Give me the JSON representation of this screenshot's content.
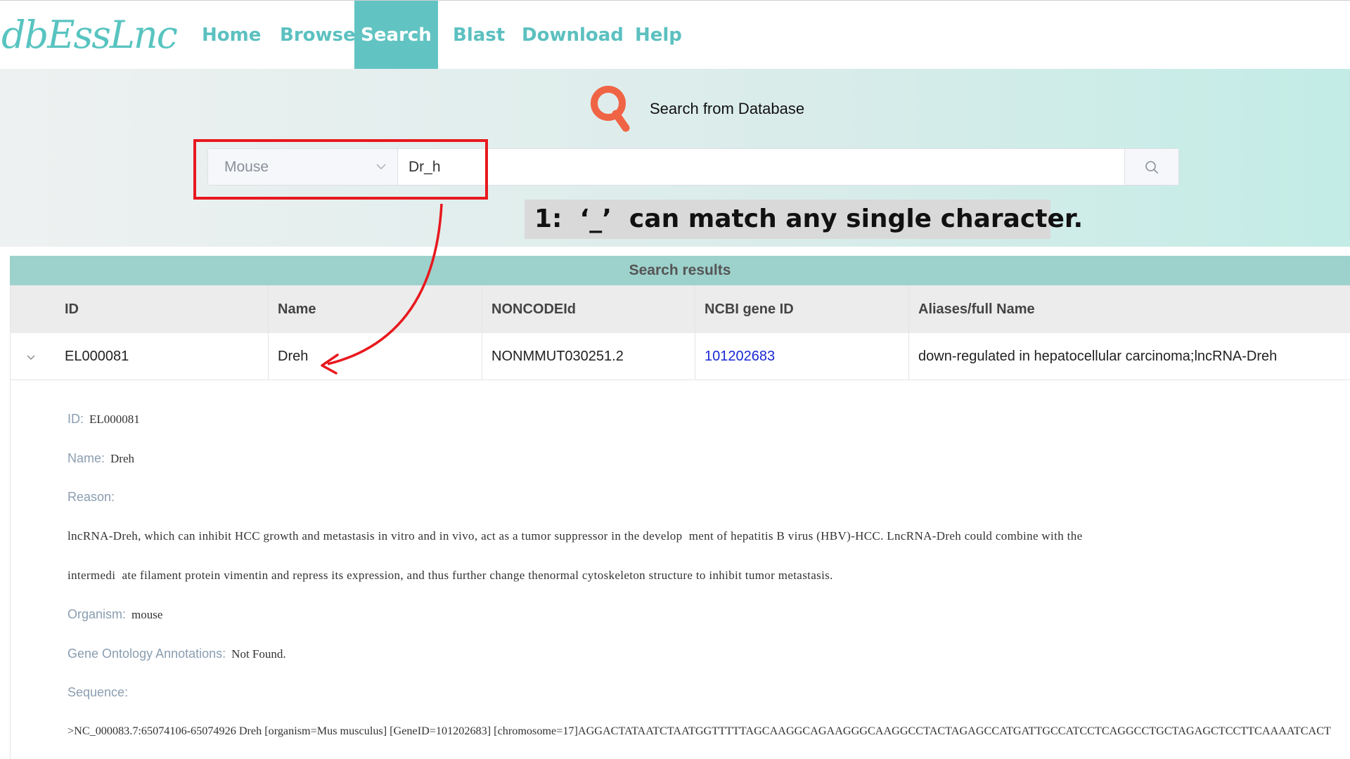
{
  "nav": {
    "logo": "dbEssLnc",
    "items": [
      {
        "label": "Home",
        "active": false
      },
      {
        "label": "Browse",
        "active": false
      },
      {
        "label": "Search",
        "active": true
      },
      {
        "label": "Blast",
        "active": false
      },
      {
        "label": "Download",
        "active": false
      },
      {
        "label": "Help",
        "active": false
      }
    ]
  },
  "search": {
    "title": "Search from Database",
    "organism_selected": "Mouse",
    "query": "Dr_h",
    "icon": "magnifier-icon"
  },
  "annotation": {
    "callout": "1:  ‘_’  can match any single character."
  },
  "results": {
    "title": "Search results",
    "columns": [
      "ID",
      "Name",
      "NONCODEId",
      "NCBI gene ID",
      "Aliases/full Name"
    ],
    "rows": [
      {
        "id": "EL000081",
        "name": "Dreh",
        "noncode_id": "NONMMUT030251.2",
        "ncbi_gene_id": "101202683",
        "aliases": "down-regulated in hepatocellular carcinoma;lncRNA-Dreh"
      }
    ]
  },
  "detail": {
    "id_label": "ID:",
    "id_value": "EL000081",
    "name_label": "Name:",
    "name_value": "Dreh",
    "reason_label": "Reason:",
    "reason_line1": "lncRNA-Dreh, which can inhibit HCC growth and metastasis in vitro and in vivo, act as a tumor suppressor in the develop  ment of hepatitis B virus (HBV)-HCC. LncRNA-Dreh could combine with the",
    "reason_line2": "intermedi  ate filament protein vimentin and repress its expression, and thus further change thenormal cytoskeleton structure to inhibit tumor metastasis.",
    "organism_label": "Organism:",
    "organism_value": "mouse",
    "go_label": "Gene Ontology Annotations:",
    "go_value": "Not Found.",
    "sequence_label": "Sequence:",
    "sequence_value": ">NC_000083.7:65074106-65074926 Dreh [organism=Mus musculus] [GeneID=101202683] [chromosome=17]AGGACTATAATCTAATGGTTTTTAGCAAGGCAGAAGGGCAAGGCCTACTAGAGCCATGATTGCCATCCTCAGGCCTGCTAGAGCTCCTTCAAAATCACT"
  },
  "colors": {
    "accent": "#62c4c2",
    "results_bar": "#9dd1cc",
    "annotation_red": "#e8181e",
    "link": "#1a28d6"
  }
}
